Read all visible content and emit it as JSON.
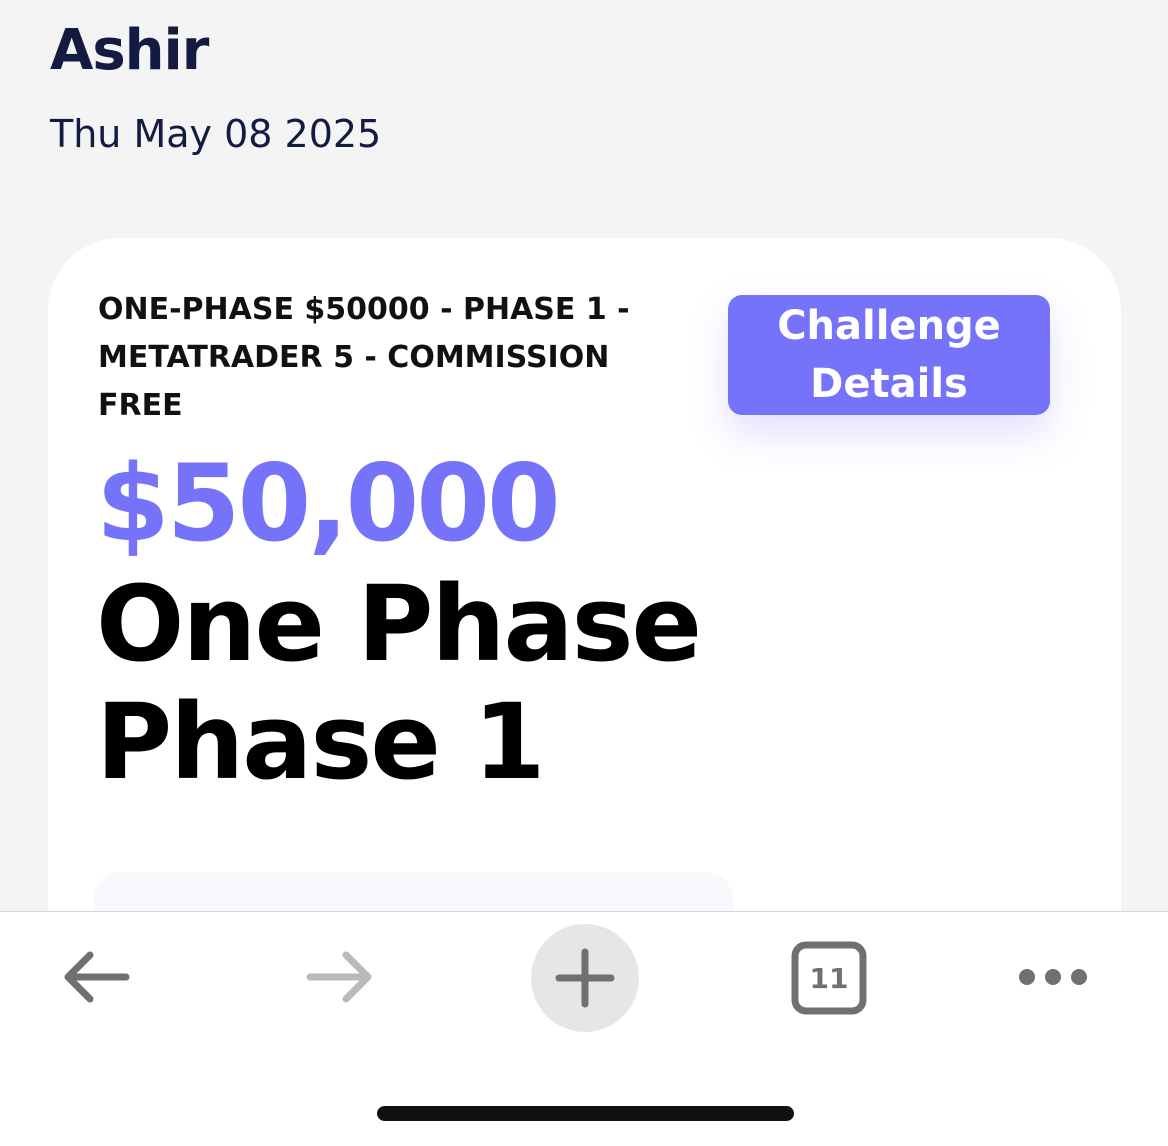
{
  "header": {
    "name": "Ashir",
    "date": "Thu May 08 2025"
  },
  "card": {
    "title": "ONE-PHASE $50000 - PHASE 1 - METATRADER 5 - COMMISSION FREE",
    "details_button": "Challenge Details",
    "amount": "$50,000",
    "plan_line1": "One Phase",
    "plan_line2": "Phase 1"
  },
  "toolbar": {
    "tab_count": "11",
    "icons": [
      "back-arrow-icon",
      "forward-arrow-icon",
      "plus-icon",
      "tabs-icon",
      "more-icon"
    ]
  },
  "colors": {
    "accent": "#7673fb",
    "heading": "#141b40",
    "background": "#f4f4f5"
  }
}
